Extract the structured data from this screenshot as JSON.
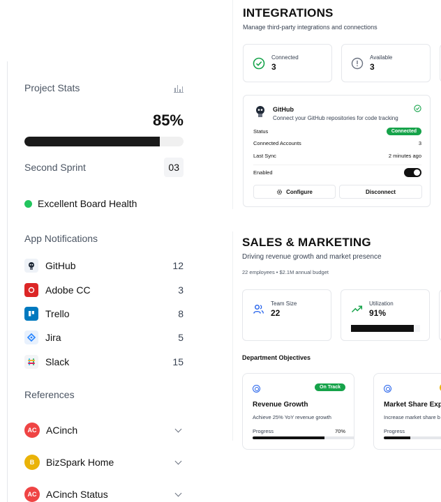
{
  "sidebar": {
    "project_stats": {
      "title": "Project Stats",
      "icon": "bar-chart-icon",
      "percent_label": "85%",
      "progress": 0.85,
      "sprint_label": "Second Sprint",
      "sprint_number": "03"
    },
    "health": {
      "label": "Excellent Board Health",
      "color": "#22c55e"
    },
    "notifications": {
      "title": "App Notifications",
      "items": [
        {
          "label": "GitHub",
          "count": "12",
          "icon": "github-icon",
          "color": "#1f2937"
        },
        {
          "label": "Adobe CC",
          "count": "3",
          "icon": "adobe-cc-icon",
          "color": "#dc2626"
        },
        {
          "label": "Trello",
          "count": "8",
          "icon": "trello-icon",
          "color": "#0079bf"
        },
        {
          "label": "Jira",
          "count": "5",
          "icon": "jira-icon",
          "color": "#2684ff"
        },
        {
          "label": "Slack",
          "count": "15",
          "icon": "slack-icon",
          "color": "#4a154b"
        }
      ]
    },
    "references": {
      "title": "References",
      "items": [
        {
          "initials": "AC",
          "label": "ACinch",
          "color": "#ef4444"
        },
        {
          "initials": "B",
          "label": "BizSpark Home",
          "color": "#eab308"
        },
        {
          "initials": "AC",
          "label": "ACinch Status",
          "color": "#ef4444"
        }
      ]
    }
  },
  "integrations": {
    "title": "INTEGRATIONS",
    "subtitle": "Manage third-party integrations and connections",
    "stats": [
      {
        "label": "Connected",
        "value": "3",
        "icon": "check-circle-icon",
        "color": "#16a34a"
      },
      {
        "label": "Available",
        "value": "3",
        "icon": "alert-circle-icon",
        "color": "#6b7280"
      }
    ],
    "github_card": {
      "name": "GitHub",
      "description": "Connect your GitHub repositories for code tracking",
      "status_label": "Status",
      "status_value": "Connected",
      "accounts_label": "Connected Accounts",
      "accounts_value": "3",
      "sync_label": "Last Sync",
      "sync_value": "2 minutes ago",
      "enabled_label": "Enabled",
      "enabled": true,
      "configure_label": "Configure",
      "disconnect_label": "Disconnect"
    }
  },
  "sales": {
    "title": "SALES & MARKETING",
    "subtitle": "Driving revenue growth and market presence",
    "meta": "22 employees • $2.1M annual budget",
    "stats": [
      {
        "label": "Team Size",
        "value": "22",
        "icon": "users-icon",
        "color": "#2563eb"
      },
      {
        "label": "Utilization",
        "value": "91%",
        "icon": "trending-up-icon",
        "color": "#16a34a",
        "progress": 0.91
      }
    ],
    "objectives_title": "Department Objectives",
    "objectives": [
      {
        "title": "Revenue Growth",
        "badge": "On Track",
        "description": "Achieve 25% YoY revenue growth",
        "progress_label": "Progress",
        "progress_value": "70%",
        "progress": 0.7
      },
      {
        "title": "Market Share Exp",
        "description": "Increase market share b",
        "progress_label": "Progress"
      }
    ]
  }
}
